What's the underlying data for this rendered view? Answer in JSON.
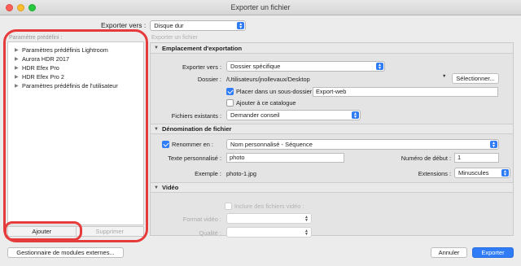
{
  "window": {
    "title": "Exporter un fichier"
  },
  "export_to": {
    "label": "Exporter vers :",
    "value": "Disque dur"
  },
  "presets": {
    "title": "Paramètre prédéfini :",
    "items": [
      {
        "label": "Paramètres prédéfinis Lightroom"
      },
      {
        "label": "Aurora HDR 2017"
      },
      {
        "label": "HDR Efex Pro"
      },
      {
        "label": "HDR Efex Pro 2"
      },
      {
        "label": "Paramètres prédéfinis de l'utilisateur"
      }
    ],
    "add_label": "Ajouter",
    "remove_label": "Supprimer"
  },
  "right": {
    "title": "Exporter un fichier",
    "location": {
      "header": "Emplacement d'exportation",
      "export_to_label": "Exporter vers :",
      "export_to_value": "Dossier spécifique",
      "folder_label": "Dossier :",
      "folder_value": "/Utilisateurs/jnollevaux/Desktop",
      "choose_label": "Sélectionner...",
      "subfolder_label": "Placer dans un sous-dossier :",
      "subfolder_value": "Export-web",
      "catalog_label": "Ajouter à ce catalogue",
      "existing_label": "Fichiers existants :",
      "existing_value": "Demander conseil"
    },
    "naming": {
      "header": "Dénomination de fichier",
      "rename_label": "Renommer en :",
      "rename_value": "Nom personnalisé - Séquence",
      "custom_text_label": "Texte personnalisé :",
      "custom_text_value": "photo",
      "start_number_label": "Numéro de début :",
      "start_number_value": "1",
      "example_label": "Exemple :",
      "example_value": "photo-1.jpg",
      "extensions_label": "Extensions :",
      "extensions_value": "Minuscules"
    },
    "video": {
      "header": "Vidéo",
      "include_label": "Inclure des fichiers vidéo :",
      "format_label": "Format vidéo :",
      "quality_label": "Qualité :"
    }
  },
  "footer": {
    "plugin_manager_label": "Gestionnaire de modules externes...",
    "cancel_label": "Annuler",
    "export_label": "Exporter"
  },
  "colors": {
    "accent": "#2f7cf6",
    "highlight": "#e63b3b"
  }
}
